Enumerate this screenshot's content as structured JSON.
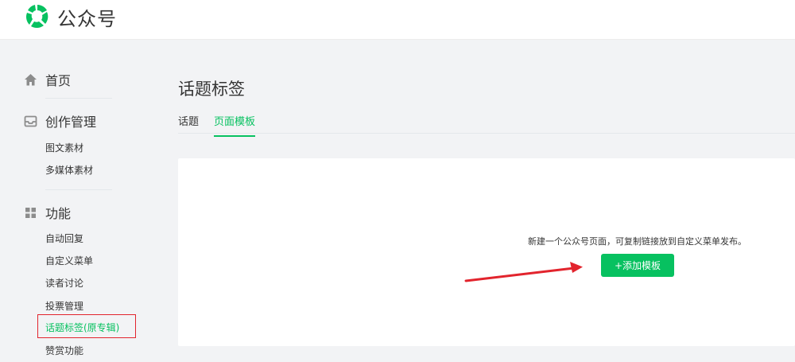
{
  "app": {
    "brand": "公众号"
  },
  "sidebar": {
    "home": {
      "label": "首页",
      "icon": "home-icon"
    },
    "creation": {
      "label": "创作管理",
      "icon": "inbox-icon",
      "items": [
        {
          "label": "图文素材"
        },
        {
          "label": "多媒体素材"
        }
      ]
    },
    "features": {
      "label": "功能",
      "icon": "grid-icon",
      "items": [
        {
          "label": "自动回复"
        },
        {
          "label": "自定义菜单"
        },
        {
          "label": "读者讨论"
        },
        {
          "label": "投票管理"
        },
        {
          "label": "话题标签(原专辑)"
        },
        {
          "label": "赞赏功能"
        }
      ]
    }
  },
  "main": {
    "title": "话题标签",
    "tabs": [
      {
        "label": "话题"
      },
      {
        "label": "页面模板",
        "active": true
      }
    ],
    "empty_hint": "新建一个公众号页面，可复制链接放到自定义菜单发布。",
    "add_button": "+添加模板"
  },
  "colors": {
    "accent": "#07c160",
    "annotation": "#e2242d",
    "background": "#f2f3f5"
  }
}
